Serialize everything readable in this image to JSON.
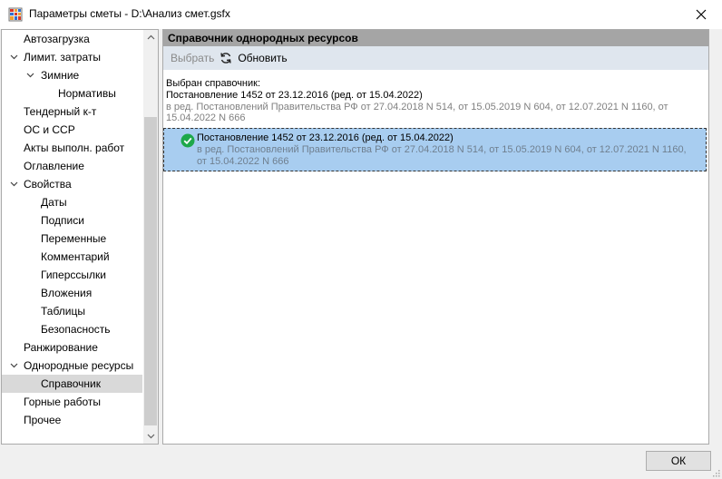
{
  "window": {
    "title": "Параметры сметы - D:\\Анализ смет.gsfx",
    "close_icon": "close-icon",
    "app_icon": "app-grid-icon"
  },
  "tree": {
    "items": [
      {
        "label": "Автозагрузка",
        "level": 0,
        "expanded": null
      },
      {
        "label": "Лимит. затраты",
        "level": 0,
        "expanded": true
      },
      {
        "label": "Зимние",
        "level": 1,
        "expanded": true
      },
      {
        "label": "Нормативы",
        "level": 2,
        "expanded": null
      },
      {
        "label": "Тендерный к-т",
        "level": 0,
        "expanded": null
      },
      {
        "label": "ОС и ССР",
        "level": 0,
        "expanded": null
      },
      {
        "label": "Акты выполн. работ",
        "level": 0,
        "expanded": null
      },
      {
        "label": "Оглавление",
        "level": 0,
        "expanded": null
      },
      {
        "label": "Свойства",
        "level": 0,
        "expanded": true
      },
      {
        "label": "Даты",
        "level": 1,
        "expanded": null
      },
      {
        "label": "Подписи",
        "level": 1,
        "expanded": null
      },
      {
        "label": "Переменные",
        "level": 1,
        "expanded": null
      },
      {
        "label": "Комментарий",
        "level": 1,
        "expanded": null
      },
      {
        "label": "Гиперссылки",
        "level": 1,
        "expanded": null
      },
      {
        "label": "Вложения",
        "level": 1,
        "expanded": null
      },
      {
        "label": "Таблицы",
        "level": 1,
        "expanded": null
      },
      {
        "label": "Безопасность",
        "level": 1,
        "expanded": null
      },
      {
        "label": "Ранжирование",
        "level": 0,
        "expanded": null
      },
      {
        "label": "Однородные ресурсы",
        "level": 0,
        "expanded": true
      },
      {
        "label": "Справочник",
        "level": 1,
        "expanded": null,
        "selected": true
      },
      {
        "label": "Горные работы",
        "level": 0,
        "expanded": null
      },
      {
        "label": "Прочее",
        "level": 0,
        "expanded": null
      }
    ]
  },
  "panel": {
    "header": "Справочник однородных ресурсов",
    "toolbar": {
      "select_label": "Выбрать",
      "refresh_label": "Обновить",
      "refresh_icon": "refresh-icon"
    },
    "selected_label": "Выбран справочник:",
    "selected_title": "Постановление 1452 от 23.12.2016 (ред. от 15.04.2022)",
    "selected_desc_1": "в ред. Постановлений Правительства РФ от 27.04.2018 N 514, от 15.05.2019 N 604, от 12.07.2021 N 1160, от",
    "selected_desc_2": "15.04.2022 N 666",
    "item": {
      "title": "Постановление 1452 от 23.12.2016 (ред. от 15.04.2022)",
      "desc_1": "в ред. Постановлений Правительства РФ от 27.04.2018 N 514, от 15.05.2019 N 604, от 12.07.2021 N 1160,",
      "desc_2": "от 15.04.2022 N 666",
      "status_icon": "check-circle-icon"
    }
  },
  "footer": {
    "ok_label": "ОК"
  },
  "colors": {
    "selection": "#a8cdf0",
    "header_bg": "#a5a5a5",
    "toolbar_bg": "#dfe6ee",
    "check": "#1ea84a"
  }
}
